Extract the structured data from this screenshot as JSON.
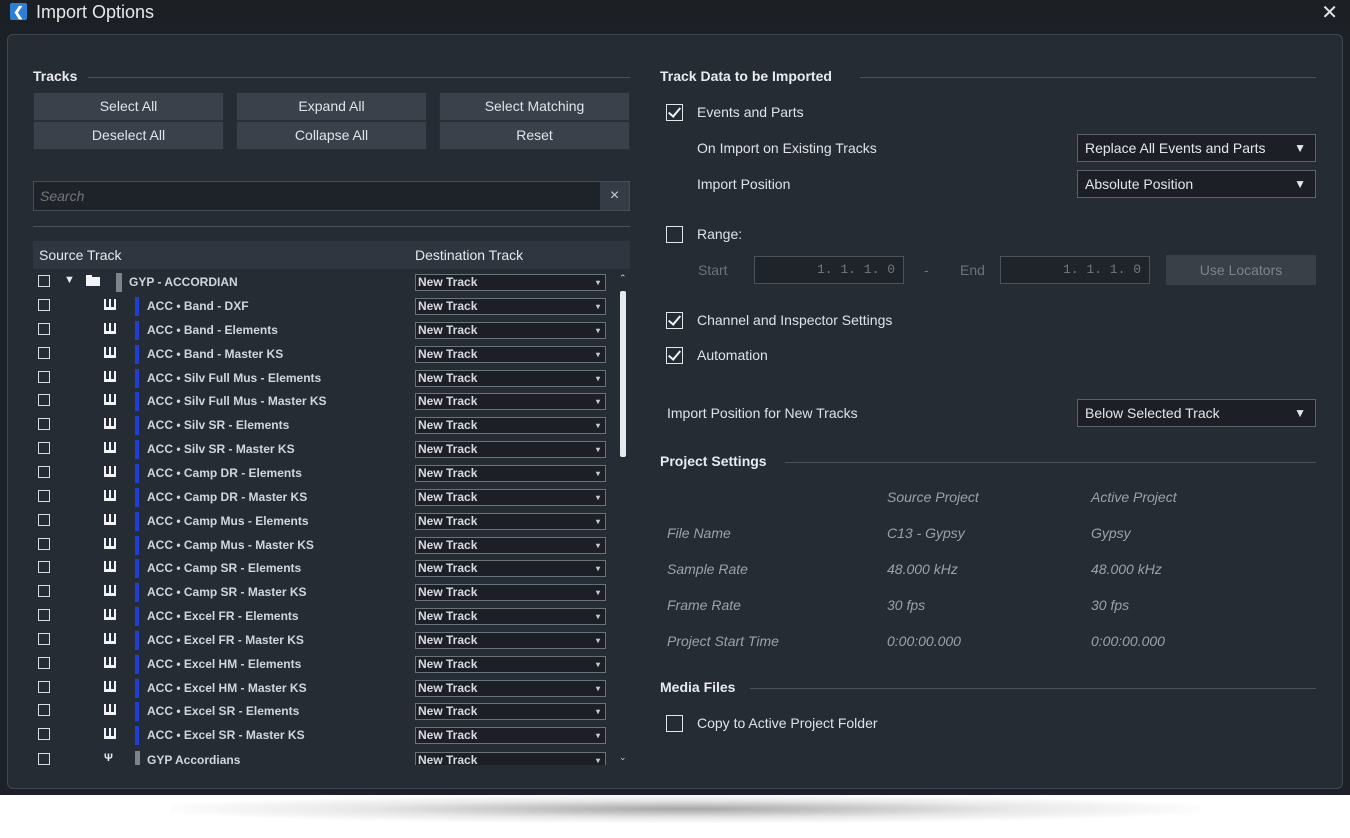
{
  "window": {
    "title": "Import Options",
    "close": "✕",
    "icon": "app-logo-icon"
  },
  "tracks": {
    "section_title": "Tracks",
    "buttons": {
      "select_all": "Select All",
      "deselect_all": "Deselect All",
      "expand_all": "Expand All",
      "collapse_all": "Collapse All",
      "select_matching": "Select Matching",
      "reset": "Reset"
    },
    "search_placeholder": "Search",
    "search_clear": "×",
    "columns": {
      "source": "Source Track",
      "destination": "Destination Track"
    },
    "folder": {
      "name": "GYP - ACCORDIAN",
      "destination": "New Track"
    },
    "rows": [
      {
        "name": "ACC • Band - DXF",
        "destination": "New Track"
      },
      {
        "name": "ACC • Band - Elements",
        "destination": "New Track"
      },
      {
        "name": "ACC • Band - Master KS",
        "destination": "New Track"
      },
      {
        "name": "ACC • Silv Full Mus - Elements",
        "destination": "New Track"
      },
      {
        "name": "ACC • Silv Full Mus - Master KS",
        "destination": "New Track"
      },
      {
        "name": "ACC • Silv SR - Elements",
        "destination": "New Track"
      },
      {
        "name": "ACC • Silv SR - Master KS",
        "destination": "New Track"
      },
      {
        "name": "ACC • Camp DR - Elements",
        "destination": "New Track"
      },
      {
        "name": "ACC • Camp DR - Master KS",
        "destination": "New Track"
      },
      {
        "name": "ACC • Camp Mus - Elements",
        "destination": "New Track"
      },
      {
        "name": "ACC • Camp Mus - Master KS",
        "destination": "New Track"
      },
      {
        "name": "ACC • Camp SR - Elements",
        "destination": "New Track"
      },
      {
        "name": "ACC • Camp SR - Master KS",
        "destination": "New Track"
      },
      {
        "name": "ACC • Excel FR - Elements",
        "destination": "New Track"
      },
      {
        "name": "ACC • Excel FR - Master KS",
        "destination": "New Track"
      },
      {
        "name": "ACC • Excel HM - Elements",
        "destination": "New Track"
      },
      {
        "name": "ACC • Excel HM - Master KS",
        "destination": "New Track"
      },
      {
        "name": "ACC • Excel SR - Elements",
        "destination": "New Track"
      },
      {
        "name": "ACC • Excel SR - Master KS",
        "destination": "New Track"
      }
    ],
    "last_row": {
      "name": "GYP Accordians",
      "destination": "New Track"
    }
  },
  "track_data": {
    "section_title": "Track Data to be Imported",
    "events_and_parts": {
      "label": "Events and Parts",
      "checked": true
    },
    "on_import_existing": {
      "label": "On Import on Existing Tracks",
      "value": "Replace All Events and Parts"
    },
    "import_position": {
      "label": "Import Position",
      "value": "Absolute Position"
    },
    "range": {
      "label": "Range:",
      "checked": false,
      "start_label": "Start",
      "start_value": "1. 1. 1.  0",
      "dash": "-",
      "end_label": "End",
      "end_value": "1. 1. 1.  0",
      "use_locators": "Use Locators"
    },
    "channel_inspector": {
      "label": "Channel and Inspector Settings",
      "checked": true
    },
    "automation": {
      "label": "Automation",
      "checked": true
    },
    "new_tracks_position": {
      "label": "Import Position for New Tracks",
      "value": "Below Selected Track"
    }
  },
  "project_settings": {
    "section_title": "Project Settings",
    "col_source": "Source Project",
    "col_active": "Active Project",
    "rows": [
      {
        "label": "File Name",
        "source": "C13 - Gypsy",
        "active": "Gypsy"
      },
      {
        "label": "Sample Rate",
        "source": "48.000 kHz",
        "active": "48.000 kHz"
      },
      {
        "label": "Frame Rate",
        "source": "30 fps",
        "active": "30 fps"
      },
      {
        "label": "Project Start Time",
        "source": "0:00:00.000",
        "active": "0:00:00.000"
      }
    ]
  },
  "media_files": {
    "section_title": "Media Files",
    "copy_to_active": {
      "label": "Copy to Active Project Folder",
      "checked": false
    }
  },
  "glyphs": {
    "dropdown": "▼",
    "small_dropdown": "▾",
    "expand": "▼",
    "up": "⌃",
    "down": "⌄"
  }
}
